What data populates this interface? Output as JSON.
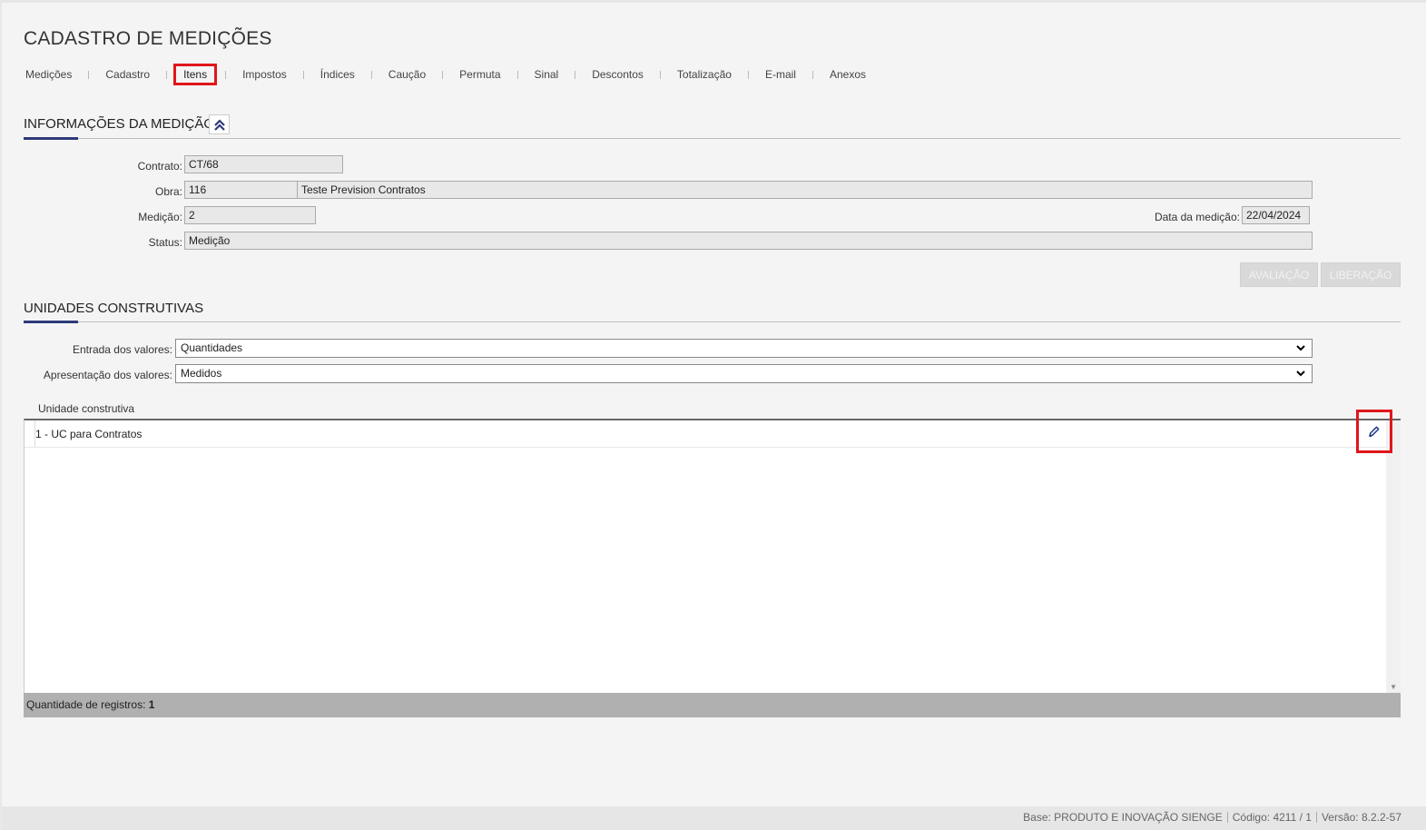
{
  "page": {
    "title": "CADASTRO DE MEDIÇÕES"
  },
  "tabs": [
    {
      "label": "Medições"
    },
    {
      "label": "Cadastro"
    },
    {
      "label": "Itens",
      "active": true
    },
    {
      "label": "Impostos"
    },
    {
      "label": "Índices"
    },
    {
      "label": "Caução"
    },
    {
      "label": "Permuta"
    },
    {
      "label": "Sinal"
    },
    {
      "label": "Descontos"
    },
    {
      "label": "Totalização"
    },
    {
      "label": "E-mail"
    },
    {
      "label": "Anexos"
    }
  ],
  "info": {
    "section_title": "INFORMAÇÕES DA MEDIÇÃO",
    "contrato_label": "Contrato:",
    "contrato_value": "CT/68",
    "obra_label": "Obra:",
    "obra_code": "116",
    "obra_name": "Teste Prevision Contratos",
    "medicao_label": "Medição:",
    "medicao_value": "2",
    "data_label": "Data da medição:",
    "data_value": "22/04/2024",
    "status_label": "Status:",
    "status_value": "Medição",
    "avaliacao_button": "AVALIAÇÃO",
    "liberacao_button": "LIBERAÇÃO"
  },
  "unidades": {
    "section_title": "UNIDADES CONSTRUTIVAS",
    "entrada_label": "Entrada dos valores:",
    "entrada_value": "Quantidades",
    "apresentacao_label": "Apresentação dos valores:",
    "apresentacao_value": "Medidos",
    "grid_header": "Unidade construtiva",
    "rows": [
      {
        "label": "1 - UC para Contratos"
      }
    ],
    "footer_label": "Quantidade de registros:",
    "footer_count": "1"
  },
  "footer": {
    "base": "Base: PRODUTO E INOVAÇÃO SIENGE",
    "codigo": "Código: 4211 / 1",
    "versao": "Versão: 8.2.2-57"
  },
  "colors": {
    "accent": "#2d3a7a",
    "highlight": "#e0161b",
    "edit_icon": "#1f3a8a"
  },
  "icons": {
    "collapse": "chevrons-up-icon",
    "edit": "pencil-icon",
    "dropdown": "chevron-down-icon"
  }
}
